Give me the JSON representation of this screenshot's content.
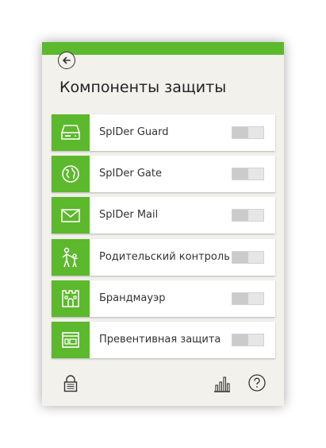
{
  "window": {
    "title": "Компоненты защиты",
    "accent_color": "#5cb82c"
  },
  "components": [
    {
      "label": "SpIDer Guard",
      "icon": "hard-drive-icon",
      "enabled": false
    },
    {
      "label": "SpIDer Gate",
      "icon": "globe-icon",
      "enabled": false
    },
    {
      "label": "SpIDer Mail",
      "icon": "envelope-icon",
      "enabled": false
    },
    {
      "label": "Родительский контроль",
      "icon": "parent-child-icon",
      "enabled": false
    },
    {
      "label": "Брандмауэр",
      "icon": "castle-tower-icon",
      "enabled": false
    },
    {
      "label": "Превентивная защита",
      "icon": "window-shield-icon",
      "enabled": false
    }
  ],
  "footer": {
    "left_icon": "lock-icon",
    "right_icons": [
      "statistics-icon",
      "help-icon"
    ]
  }
}
